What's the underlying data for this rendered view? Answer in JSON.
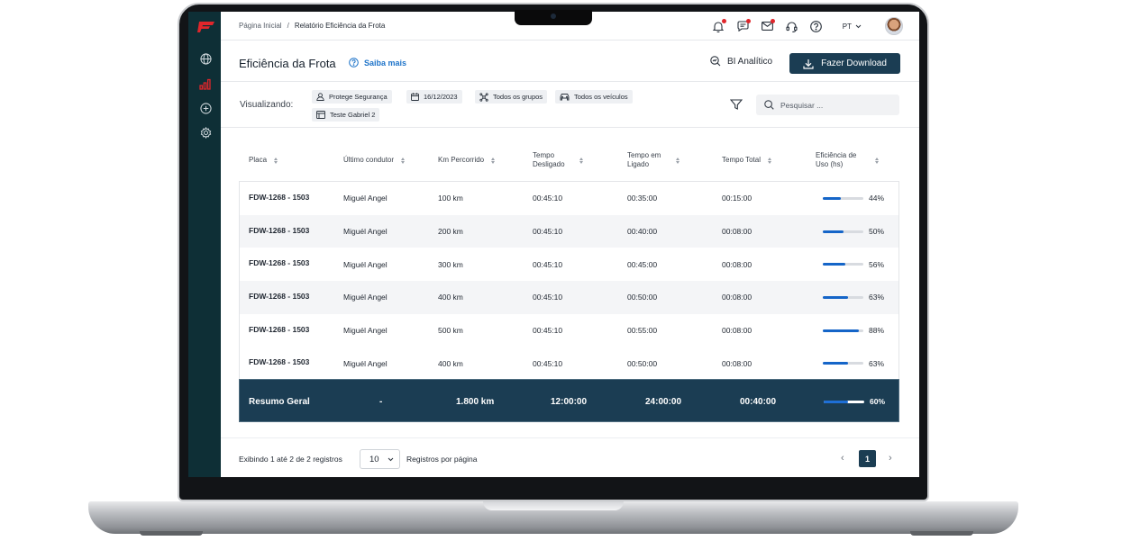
{
  "breadcrumb": {
    "home": "Página Inicial",
    "separator": "/",
    "current": "Relatório Eficiência da Frota"
  },
  "topbar": {
    "language": "PT"
  },
  "header": {
    "title": "Eficiência da Frota",
    "help_link": "Saiba mais",
    "bi_label": "BI Analítico",
    "download_label": "Fazer Download"
  },
  "filters": {
    "label": "Visualizando:",
    "chips": [
      "Protege Segurança",
      "16/12/2023",
      "Todos os grupos",
      "Todos os veículos",
      "Teste Gabriel 2"
    ],
    "search_placeholder": "Pesquisar ..."
  },
  "table": {
    "headers": [
      "Placa",
      "Último condutor",
      "Km Percorrido",
      "Tempo Desligado",
      "Tempo em Ligado",
      "Tempo Total",
      "Eficiência de Uso (hs)"
    ],
    "rows": [
      {
        "placa": "FDW-1268 - 1503",
        "condutor": "Miguél Angel",
        "km": "100 km",
        "desligado": "00:45:10",
        "ligado": "00:35:00",
        "total": "00:15:00",
        "eficiencia": "44%",
        "eficiencia_value": 0.44
      },
      {
        "placa": "FDW-1268 - 1503",
        "condutor": "Miguél Angel",
        "km": "200 km",
        "desligado": "00:45:10",
        "ligado": "00:40:00",
        "total": "00:08:00",
        "eficiencia": "50%",
        "eficiencia_value": 0.5
      },
      {
        "placa": "FDW-1268 - 1503",
        "condutor": "Miguél Angel",
        "km": "300 km",
        "desligado": "00:45:10",
        "ligado": "00:45:00",
        "total": "00:08:00",
        "eficiencia": "56%",
        "eficiencia_value": 0.56
      },
      {
        "placa": "FDW-1268 - 1503",
        "condutor": "Miguél Angel",
        "km": "400 km",
        "desligado": "00:45:10",
        "ligado": "00:50:00",
        "total": "00:08:00",
        "eficiencia": "63%",
        "eficiencia_value": 0.63
      },
      {
        "placa": "FDW-1268 - 1503",
        "condutor": "Miguél Angel",
        "km": "500 km",
        "desligado": "00:45:10",
        "ligado": "00:55:00",
        "total": "00:08:00",
        "eficiencia": "88%",
        "eficiencia_value": 0.88
      },
      {
        "placa": "FDW-1268 - 1503",
        "condutor": "Miguél Angel",
        "km": "400 km",
        "desligado": "00:45:10",
        "ligado": "00:50:00",
        "total": "00:08:00",
        "eficiencia": "63%",
        "eficiencia_value": 0.63
      }
    ],
    "summary": {
      "label": "Resumo Geral",
      "condutor": "-",
      "km": "1.800 km",
      "desligado": "12:00:00",
      "ligado": "24:00:00",
      "total": "00:40:00",
      "eficiencia": "60%",
      "eficiencia_value": 0.6
    }
  },
  "footer": {
    "showing": "Exibindo 1 até 2 de 2 registros",
    "per_page_value": "10",
    "per_page_label": "Registros por página",
    "current_page": "1"
  },
  "colors": {
    "primary": "#1b3d53",
    "sidebar": "#0e2f36",
    "accent": "#1d73c9",
    "brand": "#e0262b",
    "bar_fill": "#1565c8"
  }
}
